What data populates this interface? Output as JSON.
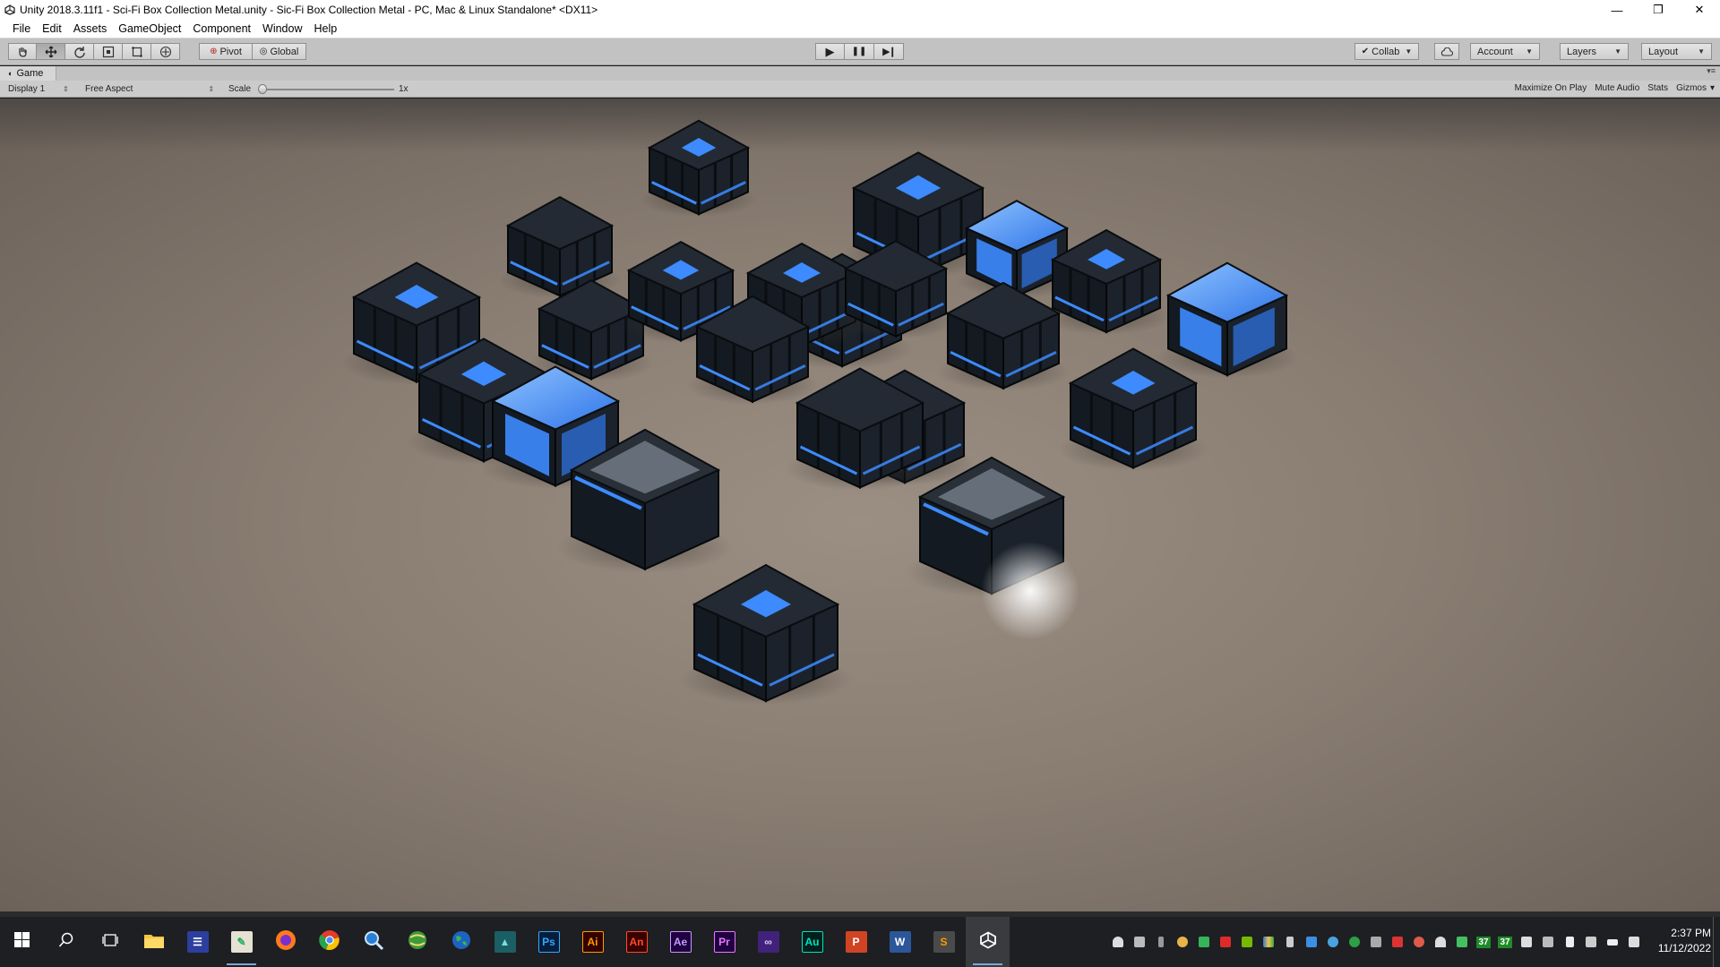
{
  "window": {
    "title": "Unity 2018.3.11f1 - Sci-Fi Box Collection Metal.unity - Sic-Fi Box Collection Metal - PC, Mac & Linux Standalone* <DX11>",
    "controls": {
      "minimize": "—",
      "restore": "❐",
      "close": "✕"
    }
  },
  "menubar": {
    "items": [
      "File",
      "Edit",
      "Assets",
      "GameObject",
      "Component",
      "Window",
      "Help"
    ]
  },
  "toolbar": {
    "tools": [
      "hand-icon",
      "move-icon",
      "rotate-icon",
      "scale-icon",
      "rect-icon",
      "transform-icon"
    ],
    "pivot_label": "Pivot",
    "global_label": "Global",
    "play": "▶",
    "pause": "❚❚",
    "step": "▶❙",
    "collab_label": "Collab",
    "account_label": "Account",
    "layers_label": "Layers",
    "layout_label": "Layout"
  },
  "game_view": {
    "tab_label": "Game",
    "display_label": "Display 1",
    "aspect_label": "Free Aspect",
    "scale_label": "Scale",
    "scale_value": "1x",
    "maximize_label": "Maximize On Play",
    "mute_label": "Mute Audio",
    "stats_label": "Stats",
    "gizmos_label": "Gizmos"
  },
  "colors": {
    "accent_blue": "#3d8bff",
    "box_dark": "#1a1f26",
    "floor": "#8a7e73"
  },
  "taskbar": {
    "apps": [
      {
        "icon": "windows-start-icon"
      },
      {
        "icon": "search-icon"
      },
      {
        "icon": "task-view-icon"
      },
      {
        "icon": "file-explorer-icon"
      },
      {
        "icon": "app-store-icon"
      },
      {
        "icon": "paint-icon"
      },
      {
        "icon": "firefox-icon"
      },
      {
        "icon": "chrome-icon"
      },
      {
        "icon": "magnifier-icon"
      },
      {
        "icon": "globe-icon"
      },
      {
        "icon": "earth-icon"
      },
      {
        "icon": "3d-app-icon"
      },
      {
        "icon": "photoshop-icon",
        "label": "Ps"
      },
      {
        "icon": "illustrator-icon",
        "label": "Ai"
      },
      {
        "icon": "animate-icon",
        "label": "An"
      },
      {
        "icon": "after-effects-icon",
        "label": "Ae"
      },
      {
        "icon": "premiere-icon",
        "label": "Pr"
      },
      {
        "icon": "visual-studio-icon"
      },
      {
        "icon": "audition-icon",
        "label": "Au"
      },
      {
        "icon": "powerpoint-icon",
        "label": "P"
      },
      {
        "icon": "word-icon",
        "label": "W"
      },
      {
        "icon": "sublime-icon"
      },
      {
        "icon": "unity-icon"
      }
    ],
    "tray_counts": [
      "37",
      "37"
    ],
    "clock_time": "2:37 PM",
    "clock_date": "11/12/2022"
  }
}
